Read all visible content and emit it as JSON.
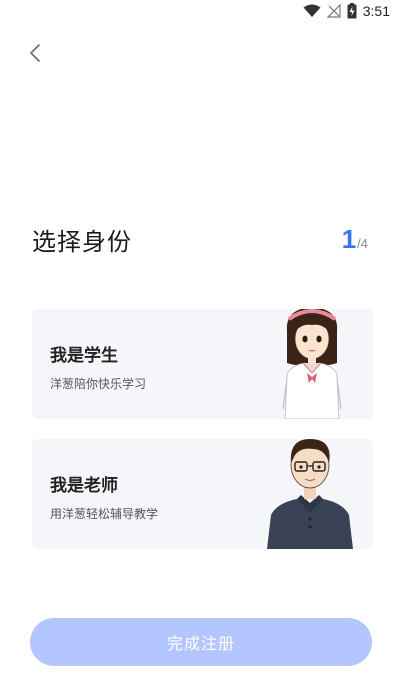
{
  "status_bar": {
    "time": "3:51",
    "icons": [
      "wifi-icon",
      "signal-icon",
      "battery-charging-icon"
    ]
  },
  "nav": {
    "back_icon": "chevron-left-icon"
  },
  "header": {
    "title": "选择身份",
    "step_current": "1",
    "step_total": "/4"
  },
  "roles": [
    {
      "title": "我是学生",
      "subtitle": "洋葱陪你快乐学习",
      "illustration": "student-avatar"
    },
    {
      "title": "我是老师",
      "subtitle": "用洋葱轻松辅导教学",
      "illustration": "teacher-avatar"
    }
  ],
  "submit": {
    "label": "完成注册",
    "enabled": false
  },
  "colors": {
    "accent": "#3b73f5",
    "card_bg": "#f4f6f9",
    "button_disabled": "#b3c6ff"
  }
}
